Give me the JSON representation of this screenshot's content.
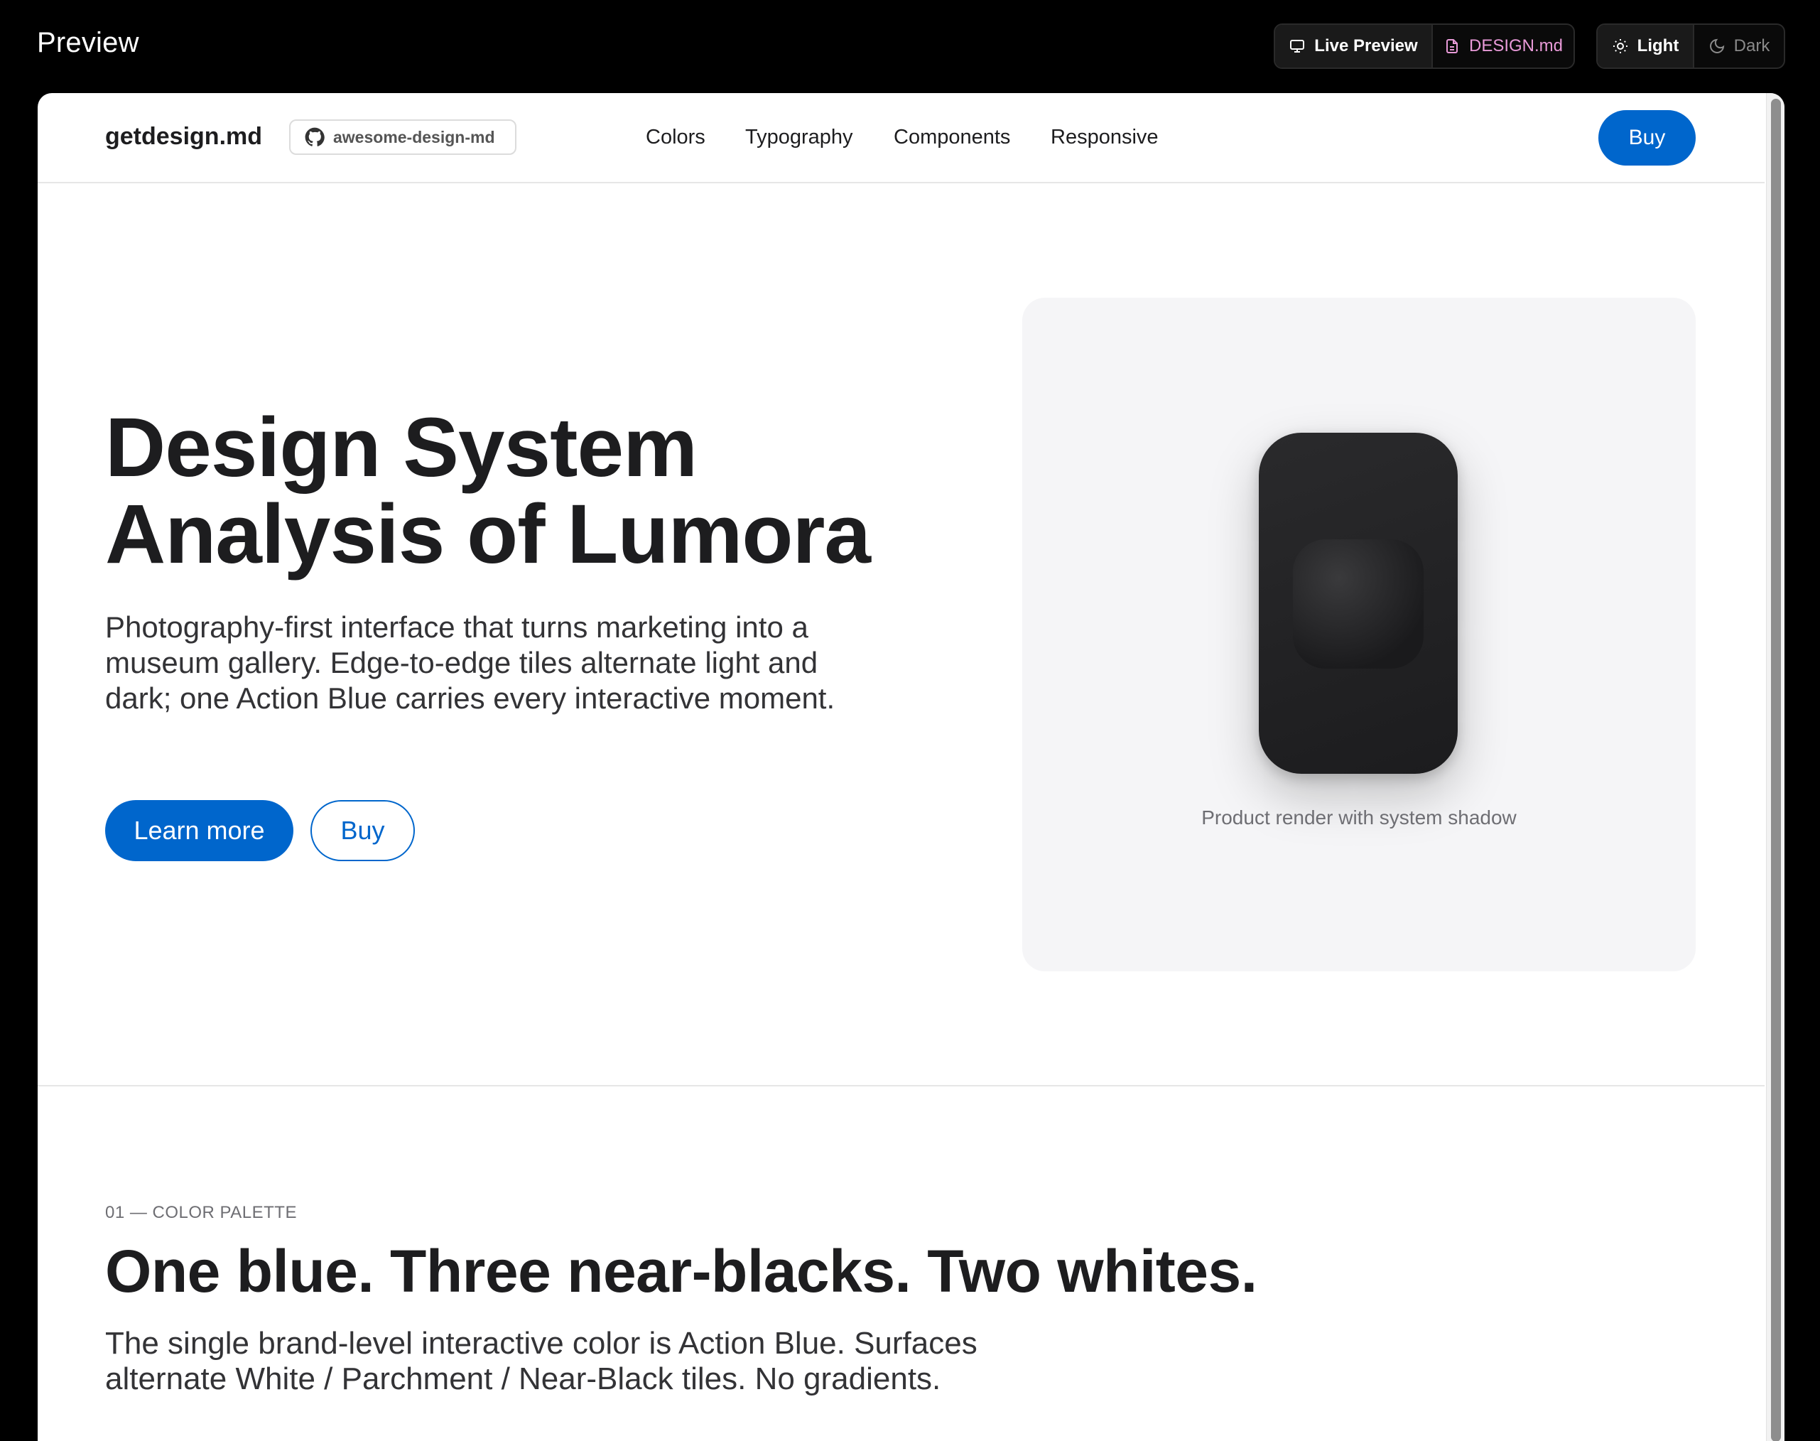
{
  "app": {
    "title": "Preview",
    "view_tabs": [
      {
        "label": "Live Preview",
        "icon": "monitor-icon",
        "active": true
      },
      {
        "label": "DESIGN.md",
        "icon": "file-icon",
        "active": false
      }
    ],
    "theme_tabs": [
      {
        "label": "Light",
        "icon": "sun-icon",
        "active": true
      },
      {
        "label": "Dark",
        "icon": "moon-icon",
        "active": false
      }
    ]
  },
  "site": {
    "brand": "getdesign.md",
    "repo_badge": "awesome-design-md",
    "nav_links": [
      "Colors",
      "Typography",
      "Components",
      "Responsive"
    ],
    "nav_buy": "Buy"
  },
  "hero": {
    "title_line1": "Design System",
    "title_line2": "Analysis of Lumora",
    "subtitle": "Photography-first interface that turns marketing into a museum gallery. Edge-to-edge tiles alternate light and dark; one Action Blue carries every interactive moment.",
    "primary_cta": "Learn more",
    "secondary_cta": "Buy",
    "tile_caption": "Product render with system shadow"
  },
  "section": {
    "eyebrow": "01 — COLOR PALETTE",
    "title": "One blue. Three near-blacks. Two whites.",
    "subtitle": "The single brand-level interactive color is Action Blue. Surfaces alternate White / Parchment / Near-Black tiles. No gradients."
  },
  "colors": {
    "action_blue": "#0066cc",
    "near_black": "#1d1d1f",
    "parchment": "#f5f5f7",
    "white": "#ffffff"
  }
}
